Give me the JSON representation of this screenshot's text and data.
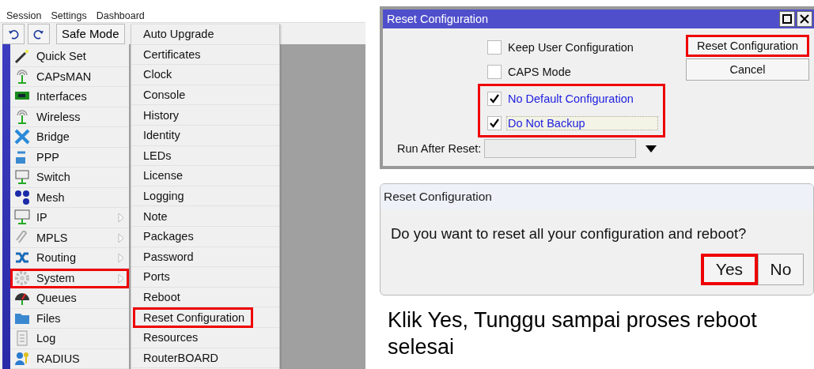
{
  "menu_bar": [
    "Session",
    "Settings",
    "Dashboard"
  ],
  "toolbar": {
    "safe_mode": "Safe Mode"
  },
  "sidebar": {
    "items": [
      {
        "label": "Quick Set",
        "has_submenu": false,
        "highlighted": false
      },
      {
        "label": "CAPsMAN",
        "has_submenu": false,
        "highlighted": false
      },
      {
        "label": "Interfaces",
        "has_submenu": false,
        "highlighted": false
      },
      {
        "label": "Wireless",
        "has_submenu": false,
        "highlighted": false
      },
      {
        "label": "Bridge",
        "has_submenu": false,
        "highlighted": false
      },
      {
        "label": "PPP",
        "has_submenu": false,
        "highlighted": false
      },
      {
        "label": "Switch",
        "has_submenu": false,
        "highlighted": false
      },
      {
        "label": "Mesh",
        "has_submenu": false,
        "highlighted": false
      },
      {
        "label": "IP",
        "has_submenu": true,
        "highlighted": false
      },
      {
        "label": "MPLS",
        "has_submenu": true,
        "highlighted": false
      },
      {
        "label": "Routing",
        "has_submenu": true,
        "highlighted": false
      },
      {
        "label": "System",
        "has_submenu": true,
        "highlighted": true
      },
      {
        "label": "Queues",
        "has_submenu": false,
        "highlighted": false
      },
      {
        "label": "Files",
        "has_submenu": false,
        "highlighted": false
      },
      {
        "label": "Log",
        "has_submenu": false,
        "highlighted": false
      },
      {
        "label": "RADIUS",
        "has_submenu": false,
        "highlighted": false
      }
    ]
  },
  "submenu": {
    "items": [
      {
        "label": "Auto Upgrade",
        "highlighted": false
      },
      {
        "label": "Certificates",
        "highlighted": false
      },
      {
        "label": "Clock",
        "highlighted": false
      },
      {
        "label": "Console",
        "highlighted": false
      },
      {
        "label": "History",
        "highlighted": false
      },
      {
        "label": "Identity",
        "highlighted": false
      },
      {
        "label": "LEDs",
        "highlighted": false
      },
      {
        "label": "License",
        "highlighted": false
      },
      {
        "label": "Logging",
        "highlighted": false
      },
      {
        "label": "Note",
        "highlighted": false
      },
      {
        "label": "Packages",
        "highlighted": false
      },
      {
        "label": "Password",
        "highlighted": false
      },
      {
        "label": "Ports",
        "highlighted": false
      },
      {
        "label": "Reboot",
        "highlighted": false
      },
      {
        "label": "Reset Configuration",
        "highlighted": true
      },
      {
        "label": "Resources",
        "highlighted": false
      },
      {
        "label": "RouterBOARD",
        "highlighted": false
      }
    ]
  },
  "reset_dialog": {
    "title": "Reset Configuration",
    "options": [
      {
        "label": "Keep User Configuration",
        "checked": false,
        "highlighted": false,
        "focused": false
      },
      {
        "label": "CAPS Mode",
        "checked": false,
        "highlighted": false,
        "focused": false
      },
      {
        "label": "No Default Configuration",
        "checked": true,
        "highlighted": true,
        "focused": false
      },
      {
        "label": "Do Not Backup",
        "checked": true,
        "highlighted": true,
        "focused": true
      }
    ],
    "run_after_reset_label": "Run After Reset:",
    "buttons": [
      {
        "label": "Reset Configuration",
        "highlighted": true
      },
      {
        "label": "Cancel",
        "highlighted": false
      }
    ]
  },
  "confirm_dialog": {
    "title": "Reset Configuration",
    "message": "Do you want to reset all your configuration and reboot?",
    "buttons": [
      {
        "label": "Yes",
        "highlighted": true
      },
      {
        "label": "No",
        "highlighted": false
      }
    ]
  },
  "caption": "Klik Yes, Tunggu sampai proses reboot selesai"
}
